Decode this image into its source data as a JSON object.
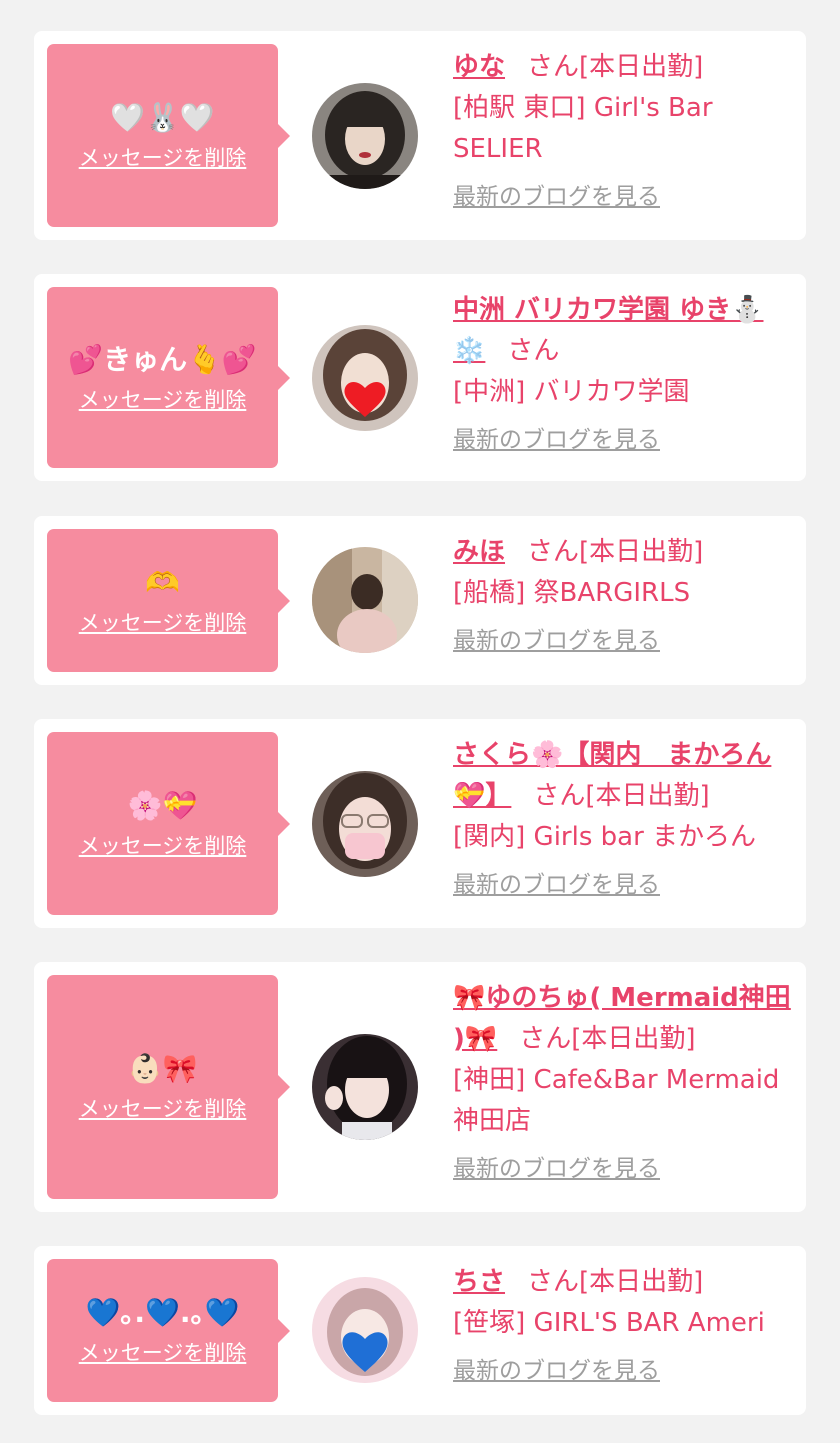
{
  "colors": {
    "page_bg": "#f2f2f2",
    "card_bg": "#ffffff",
    "bubble_bg": "#f68c9f",
    "accent_pink": "#e8436a",
    "link_gray": "#9e9e9e"
  },
  "delete_label": "メッセージを削除",
  "blog_label": "最新のブログを見る",
  "entries": [
    {
      "message": "🤍🐰🤍",
      "name": "ゆな",
      "status": "さん[本日出勤]",
      "shop": "[柏駅 東口] Girl's Bar SELIER",
      "avatar": "avatar-photo-woman-dark-hair"
    },
    {
      "message": "💕きゅん🫰💕",
      "name": "中洲 バリカワ学園 ゆき⛄️❄️",
      "status": "さん",
      "shop": "[中洲] バリカワ学園",
      "avatar": "avatar-photo-heart-sticker"
    },
    {
      "message": "🫶",
      "name": "みほ",
      "status": "さん[本日出勤]",
      "shop": "[船橋] 祭BARGIRLS",
      "avatar": "avatar-photo-outdoor"
    },
    {
      "message": "🌸💝",
      "name": "さくら🌸【関内　まかろん💝】",
      "status": "さん[本日出勤]",
      "shop": "[関内] Girls bar まかろん",
      "avatar": "avatar-photo-glasses-mask"
    },
    {
      "message": "👶🏻🎀",
      "name": "🎀ゆのちゅ( Mermaid神田 )🎀",
      "status": "さん[本日出勤]",
      "shop": "[神田] Cafe&Bar Mermaid 神田店",
      "avatar": "avatar-photo-peace-sign"
    },
    {
      "message": "💙｡.💙.｡💙",
      "name": "ちさ",
      "status": "さん[本日出勤]",
      "shop": "[笹塚] GIRL'S BAR Ameri",
      "avatar": "avatar-photo-blue-heart-sticker"
    }
  ]
}
